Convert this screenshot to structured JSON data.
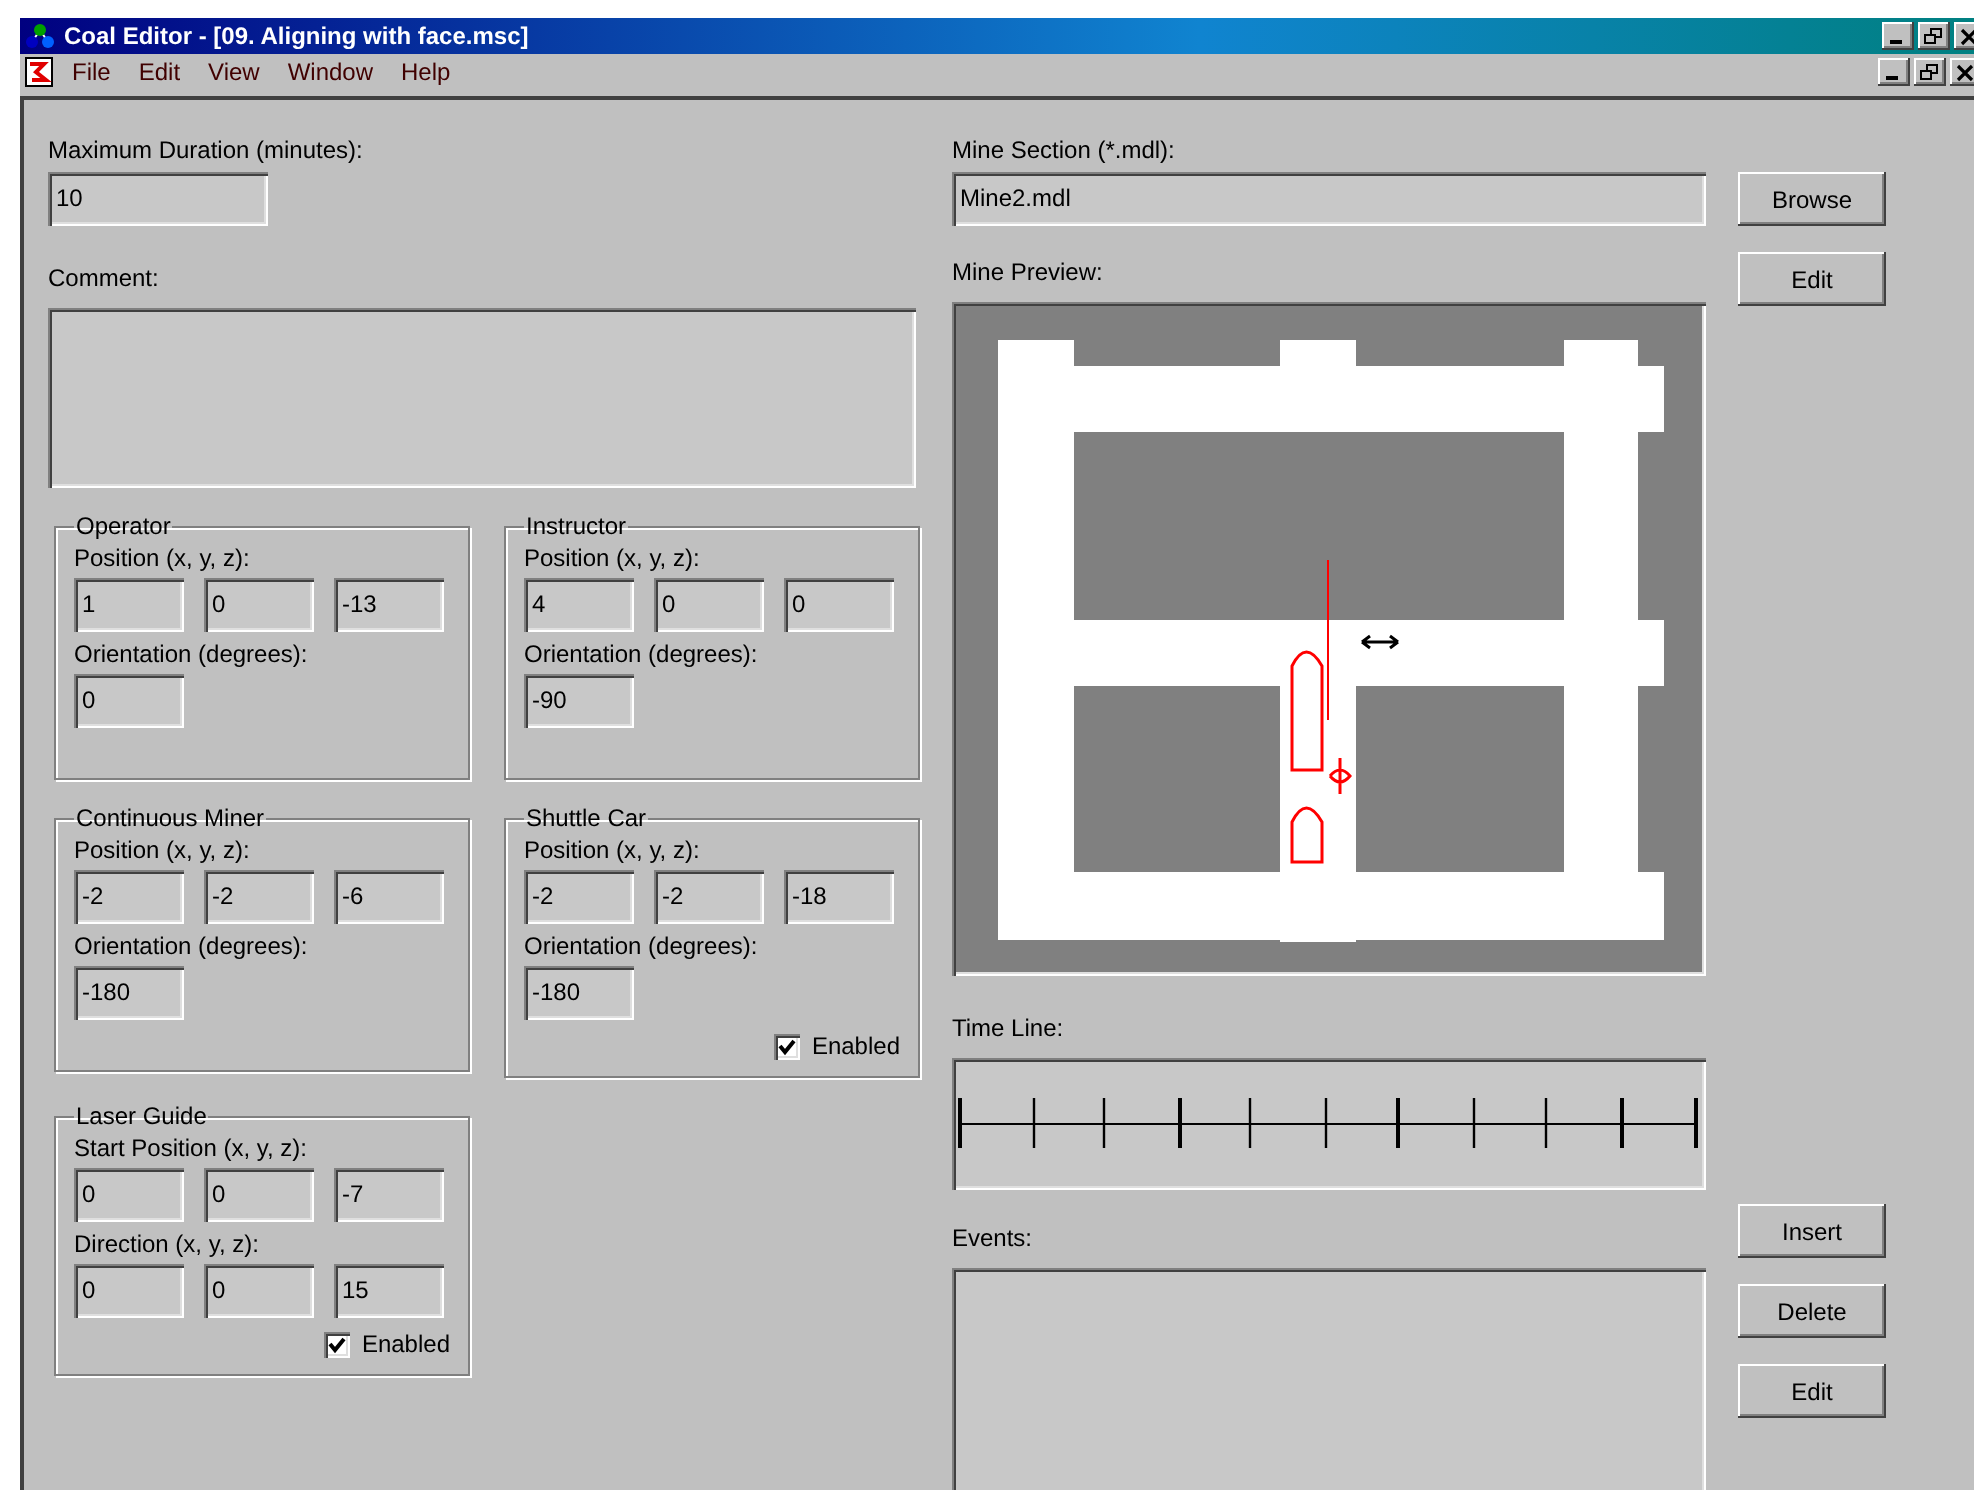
{
  "window": {
    "title": "Coal Editor - [09. Aligning with face.msc]"
  },
  "menu": [
    "File",
    "Edit",
    "View",
    "Window",
    "Help"
  ],
  "max_duration": {
    "label": "Maximum Duration (minutes):",
    "value": "10"
  },
  "comment": {
    "label": "Comment:"
  },
  "groups": [
    {
      "title": "Operator",
      "fields": [
        {
          "label": "Position (x, y, z):",
          "values": [
            "1",
            "0",
            "-13"
          ]
        },
        {
          "label": "Orientation (degrees):",
          "values": [
            "0"
          ]
        }
      ]
    },
    {
      "title": "Instructor",
      "fields": [
        {
          "label": "Position (x, y, z):",
          "values": [
            "4",
            "0",
            "0"
          ]
        },
        {
          "label": "Orientation (degrees):",
          "values": [
            "-90"
          ]
        }
      ]
    },
    {
      "title": "Continuous Miner",
      "fields": [
        {
          "label": "Position (x, y, z):",
          "values": [
            "-2",
            "-2",
            "-6"
          ]
        },
        {
          "label": "Orientation (degrees):",
          "values": [
            "-180"
          ]
        }
      ]
    },
    {
      "title": "Shuttle Car",
      "fields": [
        {
          "label": "Position (x, y, z):",
          "values": [
            "-2",
            "-2",
            "-18"
          ]
        },
        {
          "label": "Orientation (degrees):",
          "values": [
            "-180"
          ]
        }
      ],
      "checkbox": {
        "label": "Enabled",
        "checked": true
      }
    },
    {
      "title": "Laser Guide",
      "fields": [
        {
          "label": "Start Position (x, y, z):",
          "values": [
            "0",
            "0",
            "-7"
          ]
        },
        {
          "label": "Direction (x, y, z):",
          "values": [
            "0",
            "0",
            "15"
          ]
        }
      ],
      "checkbox": {
        "label": "Enabled",
        "checked": true
      }
    }
  ],
  "mine_section": {
    "label": "Mine Section (*.mdl):",
    "value": "Mine2.mdl",
    "button": "Browse"
  },
  "preview": {
    "label": "Mine Preview:",
    "button": "Edit"
  },
  "timeline": {
    "label": "Time Line:"
  },
  "events": {
    "label": "Events:",
    "buttons": [
      "Insert",
      "Delete",
      "Edit"
    ]
  }
}
